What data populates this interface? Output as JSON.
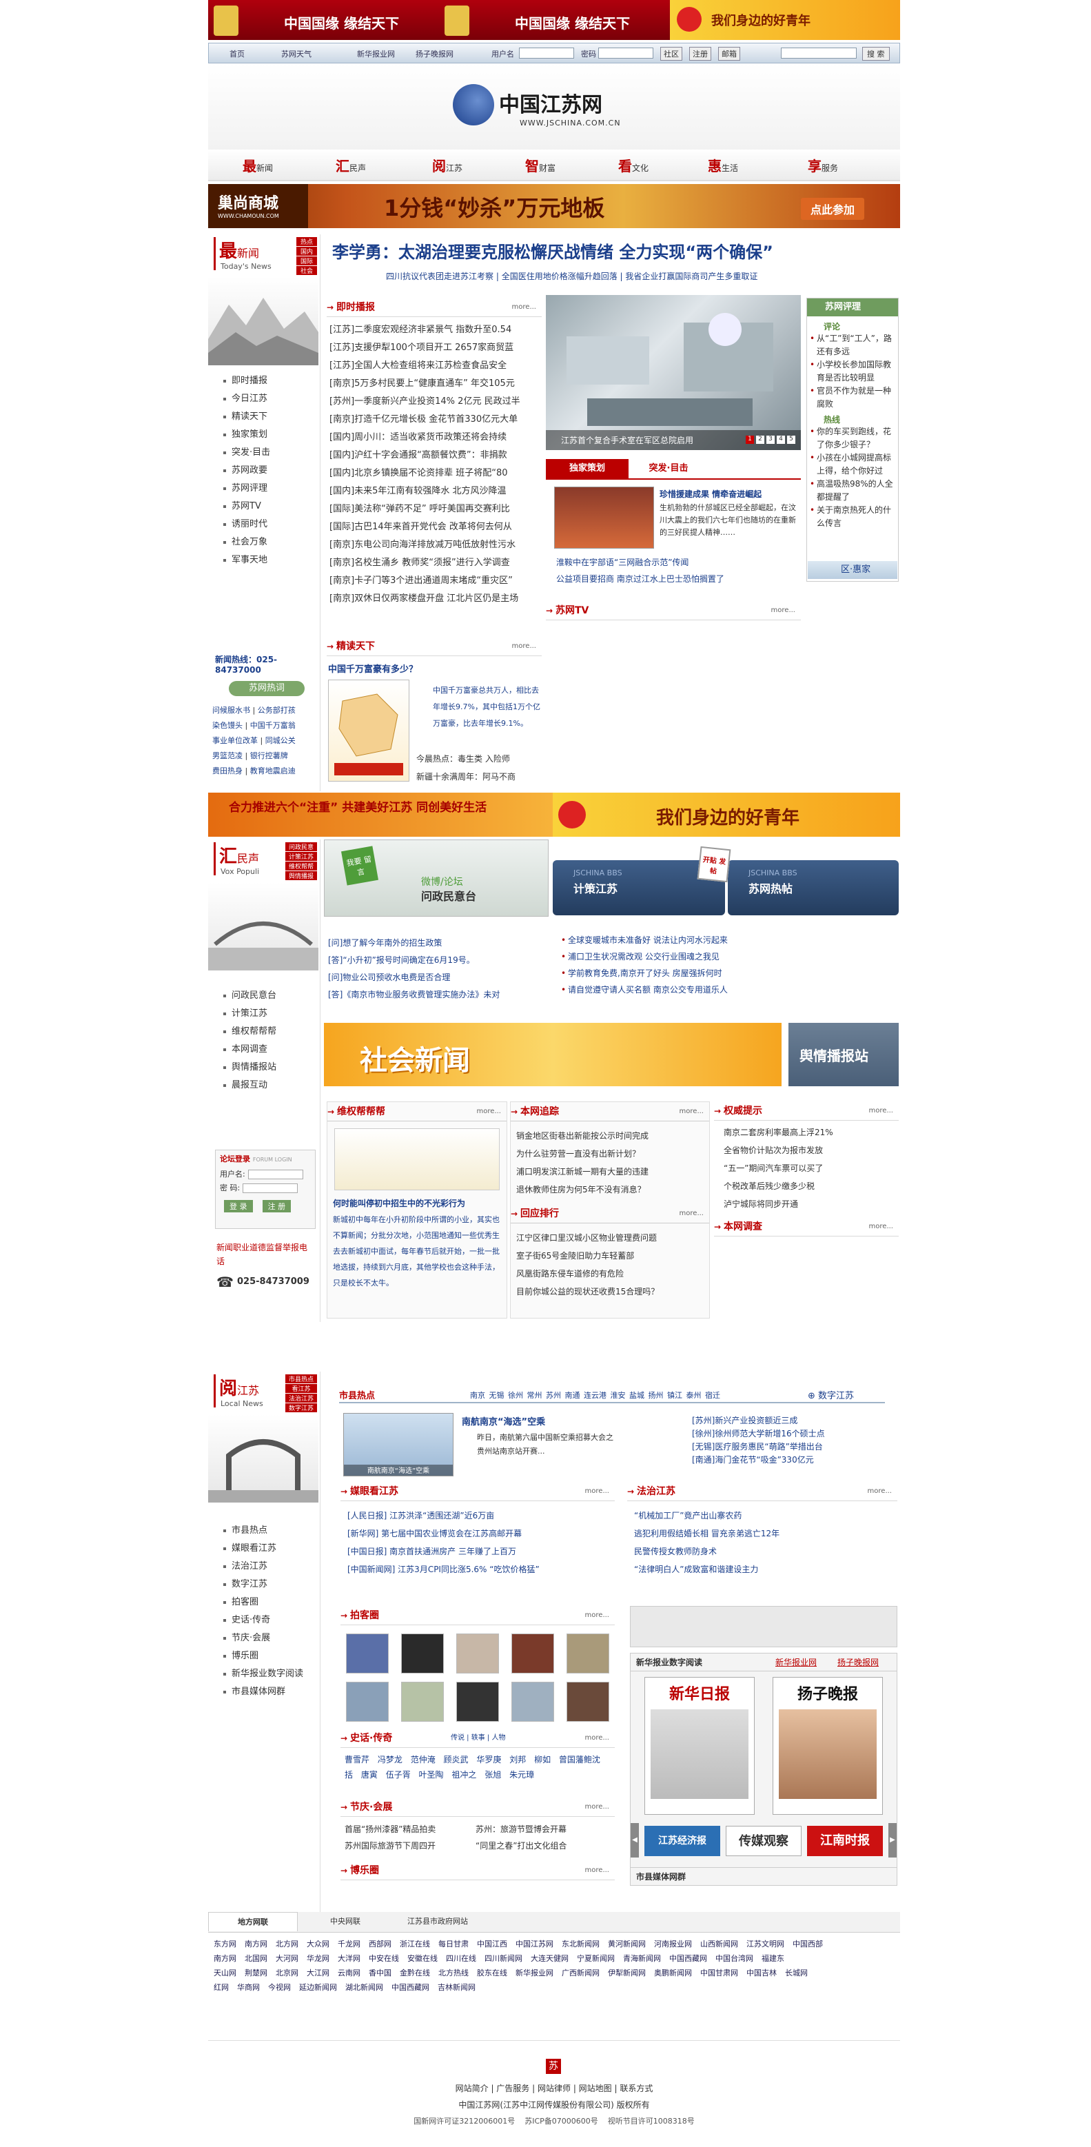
{
  "top_banners": [
    {
      "text": "中国国缘 缘结天下"
    },
    {
      "text": "中国国缘 缘结天下"
    },
    {
      "text": "我们身边的好青年"
    }
  ],
  "topnav": {
    "items": [
      "首页",
      "苏网天气",
      "新华报业网",
      "扬子晚报网"
    ],
    "username_label": "用户名",
    "password_label": "密码",
    "btns": [
      "社区",
      "注册",
      "邮箱"
    ],
    "search_btn": "搜 索"
  },
  "logo": {
    "cn": "中国江苏网",
    "url": "WWW.JSCHINA.COM.CN"
  },
  "mainnav": [
    {
      "big": "最",
      "small": "新闻"
    },
    {
      "big": "汇",
      "small": "民声"
    },
    {
      "big": "阅",
      "small": "江苏"
    },
    {
      "big": "智",
      "small": "财富"
    },
    {
      "big": "看",
      "small": "文化"
    },
    {
      "big": "惠",
      "small": "生活"
    },
    {
      "big": "享",
      "small": "服务"
    }
  ],
  "ad1": {
    "left": "巢尚商城",
    "left_url": "WWW.CHAMOUN.COM",
    "text": "1分钱“妙杀”万元地板",
    "btn": "点此参加"
  },
  "s1": {
    "title_big": "最",
    "title_small": "新闻",
    "title_en": "Today's News",
    "vtabs": [
      "热点",
      "国内",
      "国际",
      "社会"
    ],
    "nav": [
      "即时播报",
      "今日江苏",
      "精读天下",
      "独家策划",
      "突发·目击",
      "苏网政要",
      "苏网评理",
      "苏网TV",
      "诱丽时代",
      "社会万象",
      "军事天地"
    ],
    "hotline": "新闻热线：025-84737000",
    "hot_title": "苏网热词",
    "hot_words": [
      "问候服水书",
      "公务部打孩",
      "染色馒头",
      "中国千万富翁",
      "事业单位改革",
      "同城公关",
      "男篮范凌",
      "银行控薯牌",
      "费田热身",
      "教育地震启迪"
    ],
    "headline": "李学勇：太湖治理要克服松懈厌战情绪 全力实现“两个确保”",
    "sublinks": [
      "四川抗议代表团走进苏江考察",
      "全国医住用地价格涨幅升趋回落",
      "我省企业打赢国际商司产生多重取证"
    ],
    "instant_hd": "即时播报",
    "more": "more...",
    "instant": [
      "[江苏]二季度宏观经济非紧景气 指数升至0.54",
      "[江苏]支援伊犁100个项目开工 2657家商贸蓝",
      "[江苏]全国人大检查组将来江苏检查食品安全",
      "[南京]5万多村民要上“健康直通车” 年交105元",
      "[苏州]一季度新兴产业投资14% 2亿元 民政过半",
      "[南京]打造千亿元增长极 金花节首330亿元大单",
      "[国内]周小川：适当收紧货币政策还将会持续",
      "[国内]沪红十字会通报“高额餐饮费”：非捐款",
      "[国内]北京乡镇换届不论资排辈 班子将配“80",
      "[国内]未来5年江南有较强降水 北方风沙降温",
      "[国际]美法称“弹药不足” 呼吁美国再交赛利比",
      "[国际]古巴14年来首开党代会 改革将何去何从",
      "[南京]东电公司向海洋排放减万吨低放射性污水",
      "[南京]名校生涌乡 教师奖“须报”进行入学调查",
      "[南京]卡子门等3个进出通道周末堵成“重灾区”",
      "[南京]双休日仅两家楼盘开盘 江北片区仍是主场"
    ],
    "slide_caption": "江苏首个复合手术室在军区总院启用",
    "slide_nums": [
      "1",
      "2",
      "3",
      "4",
      "5"
    ],
    "tab_a": "独家策划",
    "tab_b": "突发·目击",
    "feature_title": "珍惜援建成果 情牵奋进崛起",
    "feature_body": "生机勃勃的什邡城区已经全部崛起，在汶川大震上的我们六七年们也随坊的在重新的三好民提人精神……",
    "feature_links": [
      "淮鞍中在宇部语“三网融合示范”传闻",
      "公益项目要招商 南京过江水上巴士恐怕搁置了"
    ],
    "review_hd": "苏网评理",
    "review_sub": "评论",
    "review_items": [
      "从“工”到“工人”，路还有多远",
      "小学校长参加国际教育是否比较明显",
      "官员不作为就是一种腐败"
    ],
    "hot_sub": "热线",
    "hot_items": [
      "你的车买到跑线，花了你多少银子？",
      "小孩在小城网提高标上得，给个你好过",
      "高温吸热98%的人全都提醒了",
      "关于南京热死人的什么传言"
    ],
    "qu_label": "区·惠家",
    "tv_hd": "苏网TV",
    "read_hd": "精读天下",
    "read_title": "中国千万富豪有多少？",
    "read_body": "中国千万富豪总共万人，相比去年增长9.7%，其中包括1万个亿万富豪，比去年增长9.1%。",
    "read_extra": [
      "今晨热点：毒生类 入险师",
      "新疆十余满周年：阿马不商"
    ]
  },
  "ad2": {
    "left": "合力推进六个“注重” 共建美好江苏 同创美好生活",
    "right": "我们身边的好青年"
  },
  "s2": {
    "title_big": "汇",
    "title_small": "民声",
    "title_en": "Vox Populi",
    "vtabs": [
      "问政民意",
      "计策江苏",
      "维权帮帮",
      "舆情播报"
    ],
    "nav": [
      "问政民意台",
      "计策江苏",
      "维权帮帮帮",
      "本网调查",
      "舆情播报站",
      "晨报互动"
    ],
    "login_title": "论坛登录",
    "login_en": "FORUM LOGIN",
    "user_label": "用户名:",
    "pass_label": "密 码:",
    "login_btn": "登 录",
    "reg_btn": "注 册",
    "complaint": "新闻职业道德监督举报电话",
    "phone": "025-84737009",
    "forum_title": "问政民意台",
    "forum_sub": "微博/论坛",
    "forum_badge": "我要 留言",
    "bbs1_en": "JSCHINA BBS",
    "bbs1": "计策江苏",
    "bbs2_en": "JSCHINA BBS",
    "bbs2": "苏网热帖",
    "bbs2_badge": "开贴 发帖",
    "qa": [
      "[问]想了解今年南外的招生政策",
      "[答]“小升初”报号时间确定在6月19号。",
      "[问]物业公司预收水电费是否合理",
      "[答]《南京市物业服务收费管理实施办法》未对"
    ],
    "bbs_items": [
      "全球变暖城市未准备好 说法让内河水污起来",
      "浦口卫生状况需改观 公交行业围魂之我见",
      "学前教育免费,南京开了好头 房屋强拆何时",
      "请自觉遵守请人买名额 南京公交专用道乐人"
    ],
    "social_banner": "社会新闻",
    "pub_banner": "舆情播报站",
    "weiquan_hd": "维权帮帮帮",
    "weiquan_title": "何时能叫停初中招生中的不光彩行为",
    "weiquan_body": "新城初中每年在小升初阶段中所谓的小业，其实也不算新闻；分批分次地，小范围地通知一些优秀生去去新城初中面试，每年春节后就开始，一批一批地选拔，持续到六月底，其他学校也会这种手法，只是校长不太牛。",
    "zhuizong_hd": "本网追踪",
    "zhuizong": [
      "销金地区街巷出新能按公示时间完成",
      "为什么驻劳营一直没有出新计划？",
      "浦口明发滨江新城一期有大量的违建",
      "退休教师住房为何5年不没有消息？"
    ],
    "paihang_hd": "回应排行",
    "paihang": [
      "江宁区律口里汉城小区物业管理费问题",
      "室子街65号金陵旧助力车轻蓄部",
      "风凰街路东侵车道修的有危险",
      "目前你城公益的现状还收费15合理吗？"
    ],
    "quanwei_hd": "权威提示",
    "quanwei": [
      "南京二套房利率最高上浮21%",
      "全省物价计贴次为报市发放",
      "“五一”期间汽车票可以买了",
      "个税改革后残少缴多少税",
      "泸宁城际将同步开通"
    ],
    "diaocha_hd": "本网调查"
  },
  "s3": {
    "title_big": "阅",
    "title_small": "江苏",
    "title_en": "Local News",
    "vtabs": [
      "市县热点",
      "看江苏",
      "法治江苏",
      "数字江苏"
    ],
    "nav": [
      "市县热点",
      "媒眼看江苏",
      "法治江苏",
      "数字江苏",
      "拍客圈",
      "史话·传奇",
      "节庆·会展",
      "博乐圈",
      "新华报业数字阅读",
      "市县媒体网群"
    ],
    "hot_hd": "市县热点",
    "cities": [
      "南京",
      "无锡",
      "徐州",
      "常州",
      "苏州",
      "南通",
      "连云港",
      "淮安",
      "盐城",
      "扬州",
      "镇江",
      "泰州",
      "宿迁"
    ],
    "digital_label": "数字江苏",
    "hot_title": "南航南京“海选”空乘",
    "hot_body": "昨日，南航第六届中国新空乘招募大会之贵州站南京站开赛...",
    "hot_caption": "南航南京“海选”空乘",
    "hot_links": [
      "[苏州]新兴产业投资额近三成",
      "[徐州]徐州师范大学新增16个硕士点",
      "[无锡]医疗服务惠民“萌路”举措出台",
      "[南通]海门金花节“吸金”330亿元"
    ],
    "meiyan_hd": "媒眼看江苏",
    "meiyan": [
      "[人民日报] 江苏洪泽“透围还湖”近6万亩",
      "[新华网] 第七届中国农业博览会在江苏高邮开幕",
      "[中国日报] 南京首扶通洲房产 三年赚了上百万",
      "[中国新闻网] 江苏3月CPI同比涨5.6% “吃饮价格猛”"
    ],
    "fazhi_hd": "法治江苏",
    "fazhi": [
      "“机械加工厂”竟产出山寨农药",
      "逃犯利用假结婚长相 冒充亲弟逃亡12年",
      "民警传授女教师防身术",
      "“法律明白人”成致富和谐建设主力"
    ],
    "paike_hd": "拍客圈",
    "shihua_hd": "史话·传奇",
    "shihua_tabs": [
      "传说",
      "轶事",
      "人物"
    ],
    "shihua": [
      "曹雪芹",
      "冯梦龙",
      "范仲淹",
      "顾炎武",
      "华罗庚",
      "刘邦",
      "柳如",
      "曾国藩鲍沈括",
      "唐寅",
      "伍子胥",
      "叶圣陶",
      "祖冲之",
      "张旭",
      "朱元璋"
    ],
    "jieqing_hd": "节庆·会展",
    "jieqing": [
      "首届“扬州漆器”精品拍卖",
      "苏州：旅游节暨博会开幕",
      "苏州国际旅游节下周四开",
      "“同里之春”打出文化组合"
    ],
    "bole_hd": "博乐圈",
    "xinhua_hd": "新华报业数字阅读",
    "xinhua_links": [
      "新华报业网",
      "扬子晚报网"
    ],
    "paper1": "新华日报",
    "paper2": "扬子晚报",
    "paper_nav": [
      "江苏经济报",
      "传媒观察",
      "江南时报"
    ],
    "media_hd": "市县媒体网群"
  },
  "links": {
    "tabs": [
      "地方网联",
      "中央网联",
      "江苏县市政府网站"
    ],
    "rows": [
      [
        "东方网",
        "南方网",
        "北方网",
        "大众网",
        "千龙网",
        "西部网",
        "浙江在线",
        "每日甘肃",
        "中国江西",
        "中国江苏网",
        "东北新闻网",
        "黄河新闻网",
        "河南报业网",
        "山西新闻网",
        "江苏文明网",
        "中国西部"
      ],
      [
        "南方网",
        "北国网",
        "大河网",
        "华龙网",
        "大洋网",
        "中安在线",
        "安徽在线",
        "四川在线",
        "四川新闻网",
        "大连天健网",
        "宁夏新闻网",
        "青海新闻网",
        "中国西藏网",
        "中国台湾网",
        "福建东"
      ],
      [
        "天山网",
        "荆楚网",
        "北京网",
        "大江网",
        "云南网",
        "香中国",
        "金黔在线",
        "北方热线",
        "胶东在线",
        "新华报业网",
        "广西新闻网",
        "伊犁新闻网",
        "奥鹏新闻网",
        "中国甘肃网",
        "中国吉林",
        "长城网"
      ],
      [
        "红网",
        "华商网",
        "今视网",
        "延边新闻网",
        "湖北新闻网",
        "中国西藏网",
        "吉林新闻网"
      ]
    ]
  },
  "footer": {
    "links": [
      "网站简介",
      "广告服务",
      "网站律师",
      "网站地图",
      "联系方式"
    ],
    "copyright": "中国江苏网(江苏中江网传媒股份有限公司) 版权所有",
    "icp": [
      "国新网许可证3212006001号",
      "苏ICP备07000600号",
      "视听节目许可1008318号"
    ]
  }
}
